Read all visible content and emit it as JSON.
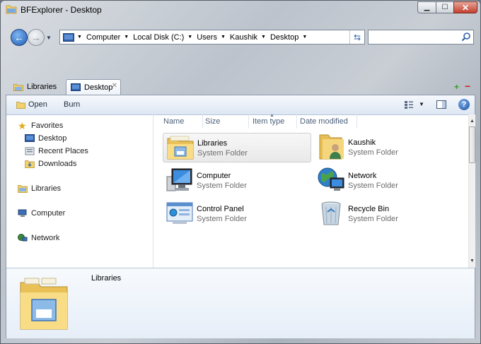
{
  "window": {
    "title": "BFExplorer - Desktop"
  },
  "address": {
    "crumbs": [
      "Computer",
      "Local Disk (C:)",
      "Users",
      "Kaushik",
      "Desktop"
    ]
  },
  "tabs": [
    {
      "label": "Libraries",
      "active": false
    },
    {
      "label": "Desktop",
      "active": true
    }
  ],
  "toolbar": {
    "open_label": "Open",
    "burn_label": "Burn"
  },
  "columns": [
    "Name",
    "Size",
    "Item type",
    "Date modified"
  ],
  "nav": {
    "favorites": "Favorites",
    "favorite_items": [
      "Desktop",
      "Recent Places",
      "Downloads"
    ],
    "libraries": "Libraries",
    "computer": "Computer",
    "network": "Network"
  },
  "items": [
    {
      "name": "Libraries",
      "type": "System Folder",
      "icon": "libraries-folder-icon",
      "selected": true
    },
    {
      "name": "Kaushik",
      "type": "System Folder",
      "icon": "user-folder-icon",
      "selected": false
    },
    {
      "name": "Computer",
      "type": "System Folder",
      "icon": "computer-icon",
      "selected": false
    },
    {
      "name": "Network",
      "type": "System Folder",
      "icon": "network-globe-icon",
      "selected": false
    },
    {
      "name": "Control Panel",
      "type": "System Folder",
      "icon": "control-panel-icon",
      "selected": false
    },
    {
      "name": "Recycle Bin",
      "type": "System Folder",
      "icon": "recycle-bin-icon",
      "selected": false
    }
  ],
  "details": {
    "name": "Libraries"
  },
  "colors": {
    "accent": "#1f5db8",
    "selection": "#e9e9e9"
  }
}
